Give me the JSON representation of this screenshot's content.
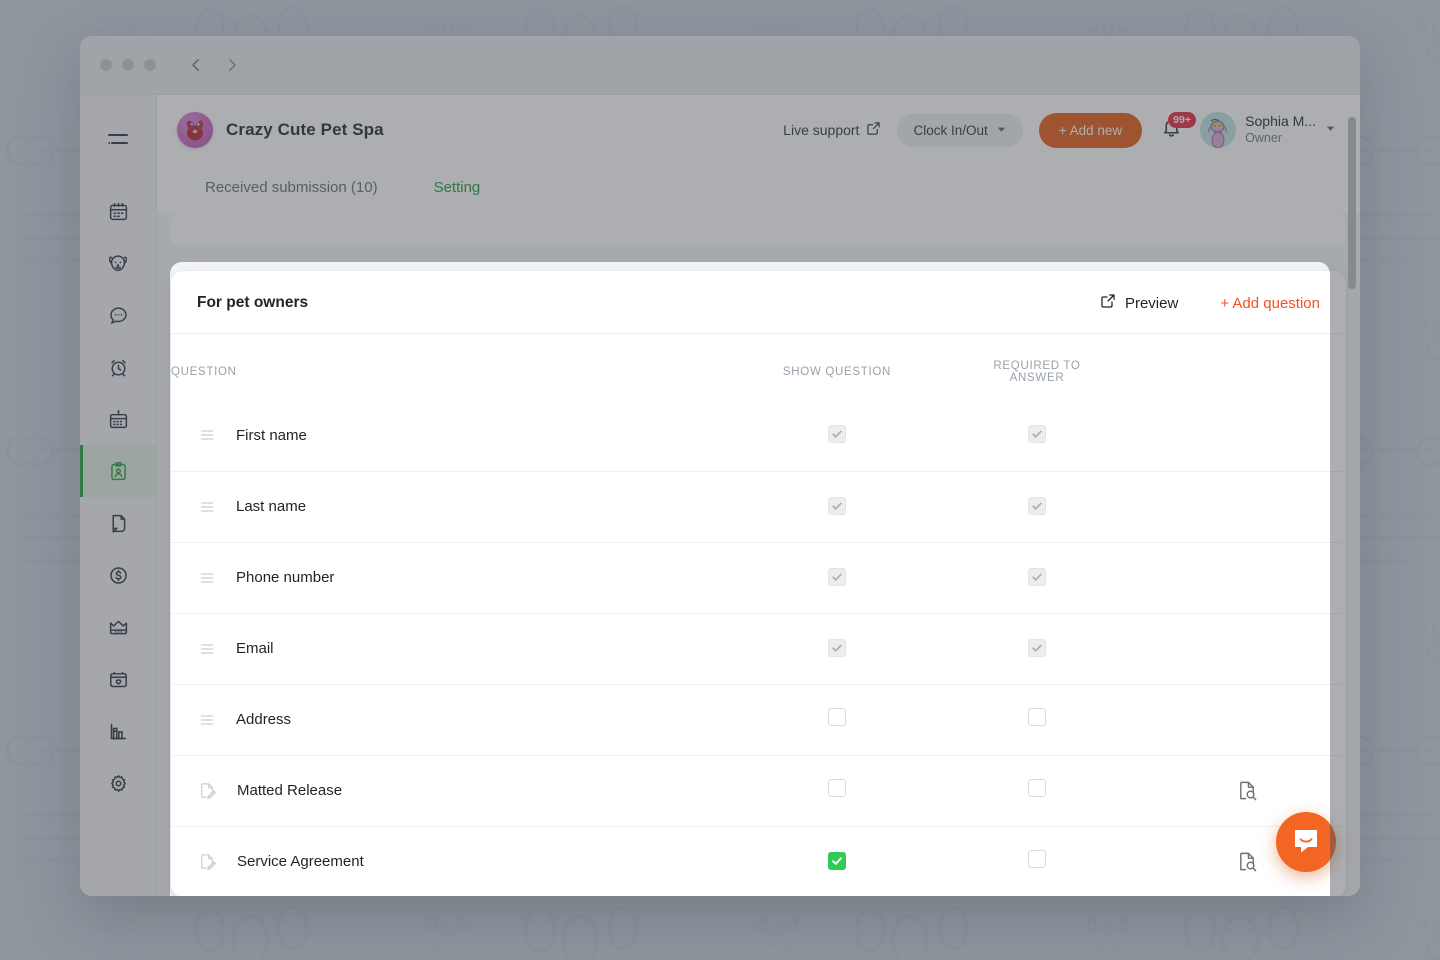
{
  "window": {
    "traffic_lights": [
      "close",
      "minimize",
      "maximize"
    ],
    "back_label": "Back",
    "forward_label": "Forward"
  },
  "sidebar": {
    "items": [
      {
        "icon": "hamburger-menu-icon",
        "label": "Menu",
        "active": false
      },
      {
        "icon": "calendar-icon",
        "label": "Calendar",
        "active": false
      },
      {
        "icon": "dog-face-icon",
        "label": "Pets",
        "active": false
      },
      {
        "icon": "chat-bubble-icon",
        "label": "Messages",
        "active": false
      },
      {
        "icon": "alarm-clock-icon",
        "label": "Reminders",
        "active": false
      },
      {
        "icon": "calendar-pin-icon",
        "label": "Schedule",
        "active": false
      },
      {
        "icon": "clipboard-person-icon",
        "label": "Forms",
        "active": true
      },
      {
        "icon": "document-page-icon",
        "label": "Documents",
        "active": false
      },
      {
        "icon": "dollar-circle-icon",
        "label": "Payments",
        "active": false
      },
      {
        "icon": "crown-icon",
        "label": "Memberships",
        "active": false
      },
      {
        "icon": "package-heart-icon",
        "label": "Packages",
        "active": false
      },
      {
        "icon": "bar-chart-icon",
        "label": "Reports",
        "active": false
      },
      {
        "icon": "gear-icon",
        "label": "Settings",
        "active": false
      }
    ]
  },
  "appbar": {
    "brand_name": "Crazy Cute Pet Spa",
    "brand_logo": "pet-spa-logo",
    "live_support": "Live support",
    "live_support_icon": "external-link-icon",
    "clock_in_out": "Clock In/Out",
    "clock_chevron_icon": "chevron-down-icon",
    "add_new": "+ Add new",
    "bell_icon": "bell-icon",
    "notification_count": "99+",
    "avatar": "user-avatar-dog",
    "user_name": "Sophia M...",
    "user_role": "Owner",
    "user_chevron_icon": "chevron-down-icon"
  },
  "tabs": [
    {
      "label": "Received submission (10)",
      "active": false
    },
    {
      "label": "Setting",
      "active": true
    }
  ],
  "card": {
    "title": "For pet owners",
    "preview_label": "Preview",
    "preview_icon": "external-link-icon",
    "add_question_label": "+ Add question"
  },
  "table": {
    "columns": [
      {
        "key": "question",
        "label": "QUESTION"
      },
      {
        "key": "show",
        "label": "SHOW QUESTION"
      },
      {
        "key": "required",
        "label": "REQUIRED TO\nANSWER"
      },
      {
        "key": "action",
        "label": ""
      }
    ],
    "rows": [
      {
        "label": "First name",
        "lead_icon": "drag-handle-icon",
        "show": "disabled-checked",
        "required": "disabled-checked",
        "action_icon": ""
      },
      {
        "label": "Last name",
        "lead_icon": "drag-handle-icon",
        "show": "disabled-checked",
        "required": "disabled-checked",
        "action_icon": ""
      },
      {
        "label": "Phone number",
        "lead_icon": "drag-handle-icon",
        "show": "disabled-checked",
        "required": "disabled-checked",
        "action_icon": ""
      },
      {
        "label": "Email",
        "lead_icon": "drag-handle-icon",
        "show": "disabled-checked",
        "required": "disabled-checked",
        "action_icon": ""
      },
      {
        "label": "Address",
        "lead_icon": "drag-handle-icon",
        "show": "empty",
        "required": "empty",
        "action_icon": ""
      },
      {
        "label": "Matted Release",
        "lead_icon": "document-sign-icon",
        "show": "empty",
        "required": "empty",
        "action_icon": "document-search-icon"
      },
      {
        "label": "Service Agreement",
        "lead_icon": "document-sign-icon",
        "show": "checked",
        "required": "empty",
        "action_icon": "document-search-icon"
      }
    ]
  },
  "chat_launcher": {
    "icon": "intercom-chat-icon",
    "label": "Open chat"
  },
  "colors": {
    "accent_orange": "#f4511e",
    "add_new_orange": "#e85a14",
    "active_green": "#21a038",
    "tab_green": "#17a030",
    "checkbox_green": "#2ecc56",
    "badge_red": "#e8263c",
    "launcher_orange": "#f26522"
  }
}
